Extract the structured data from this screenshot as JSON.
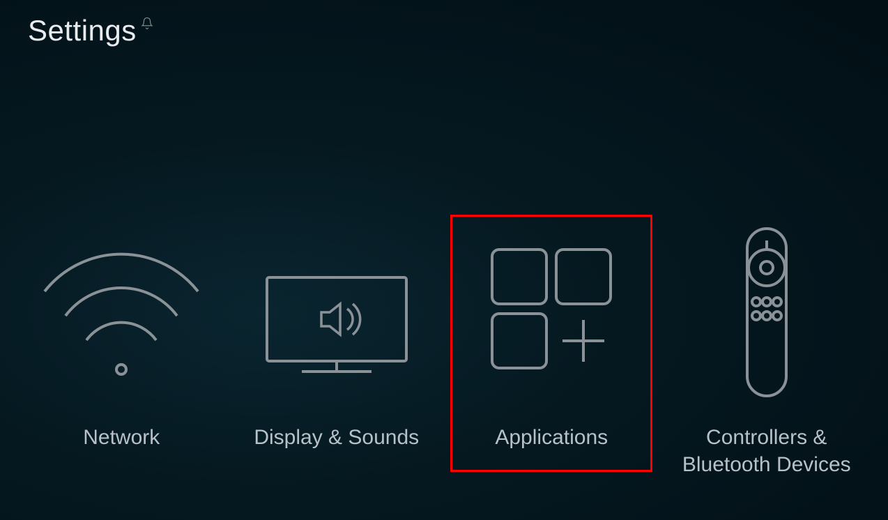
{
  "header": {
    "title": "Settings"
  },
  "tiles": [
    {
      "id": "network",
      "label": "Network",
      "icon": "wifi-icon",
      "highlighted": false
    },
    {
      "id": "display-sounds",
      "label": "Display & Sounds",
      "icon": "tv-speaker-icon",
      "highlighted": false
    },
    {
      "id": "applications",
      "label": "Applications",
      "icon": "apps-grid-icon",
      "highlighted": true
    },
    {
      "id": "controllers-bluetooth",
      "label": "Controllers & Bluetooth Devices",
      "icon": "remote-icon",
      "highlighted": false
    }
  ]
}
